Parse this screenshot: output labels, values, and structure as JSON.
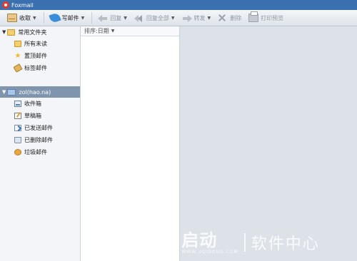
{
  "window": {
    "title": "Foxmail"
  },
  "toolbar": {
    "receive_label": "收取",
    "compose_label": "写邮件",
    "reply_label": "回复",
    "reply_all_label": "回复全部",
    "forward_label": "转发",
    "delete_label": "删除",
    "print_preview_label": "打印预览"
  },
  "folders": {
    "common_group_label": "常用文件夹",
    "common": [
      {
        "label": "所有未读",
        "icon": "folder-icon"
      },
      {
        "label": "置顶邮件",
        "icon": "star-icon"
      },
      {
        "label": "标签邮件",
        "icon": "tag-icon"
      }
    ],
    "account_label": "zol(hao.na)",
    "account": [
      {
        "label": "收件箱",
        "icon": "inbox-icon"
      },
      {
        "label": "草稿箱",
        "icon": "draft-icon"
      },
      {
        "label": "已发送邮件",
        "icon": "sent-icon"
      },
      {
        "label": "已删除邮件",
        "icon": "trash-icon"
      },
      {
        "label": "垃圾邮件",
        "icon": "spam-icon"
      }
    ]
  },
  "message_list": {
    "sort_label": "排序:日期"
  },
  "watermark": {
    "logo": "U",
    "brand": "启动",
    "url": "WWW.UQIDONG.COM",
    "tagline": "软件中心"
  },
  "colors": {
    "titlebar": "#3a6fb0",
    "account_header": "#7f95ad",
    "preview_bg": "#dde2e8"
  }
}
